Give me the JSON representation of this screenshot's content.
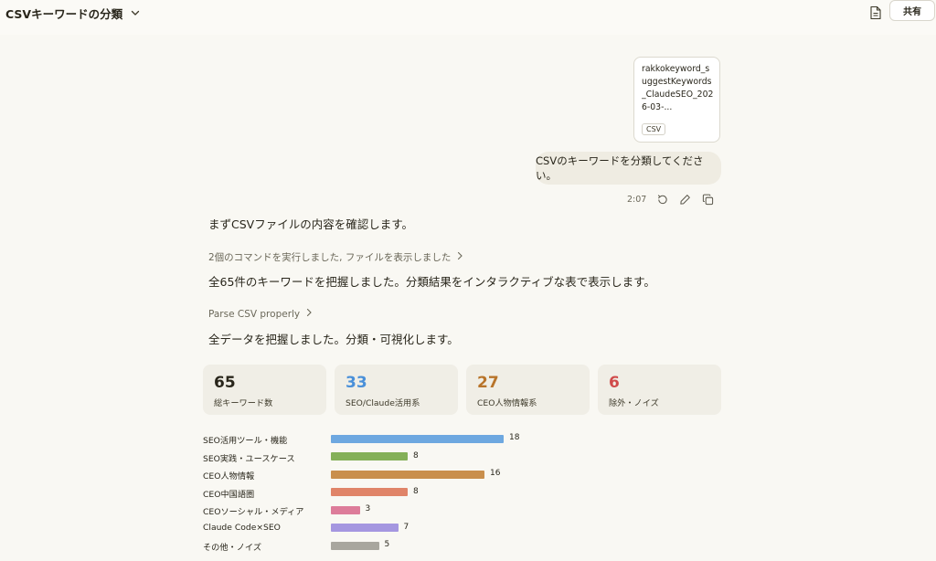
{
  "header": {
    "title": "CSVキーワードの分類",
    "share_label": "共有"
  },
  "attachment": {
    "name": "rakkokeyword_suggestKeywords_ClaudeSEO_2026-03-...",
    "type": "CSV"
  },
  "user_message": {
    "text": "CSVのキーワードを分類してください。",
    "time": "2:07"
  },
  "assistant": {
    "line1": "まずCSVファイルの内容を確認します。",
    "tool1": "2個のコマンドを実行しました, ファイルを表示しました",
    "line2": "全65件のキーワードを把握しました。分類結果をインタラクティブな表で表示します。",
    "tool2": "Parse CSV properly",
    "line3": "全データを把握しました。分類・可視化します。"
  },
  "stats": [
    {
      "value": "65",
      "label": "総キーワード数",
      "color": "#29261b"
    },
    {
      "value": "33",
      "label": "SEO/Claude活用系",
      "color": "#4a90d9"
    },
    {
      "value": "27",
      "label": "CEO人物情報系",
      "color": "#b8742a"
    },
    {
      "value": "6",
      "label": "除外・ノイズ",
      "color": "#d04a4a"
    }
  ],
  "chart_data": {
    "type": "bar",
    "orientation": "horizontal",
    "categories": [
      "SEO活用ツール・機能",
      "SEO実践・ユースケース",
      "CEO人物情報",
      "CEO中国語圏",
      "CEOソーシャル・メディア",
      "Claude Code×SEO",
      "その他・ノイズ"
    ],
    "values": [
      18,
      8,
      16,
      8,
      3,
      7,
      5
    ],
    "colors": [
      "#6ea8e0",
      "#84b058",
      "#c98f4d",
      "#e08468",
      "#dd7c9a",
      "#a597e0",
      "#a8a69e"
    ]
  }
}
